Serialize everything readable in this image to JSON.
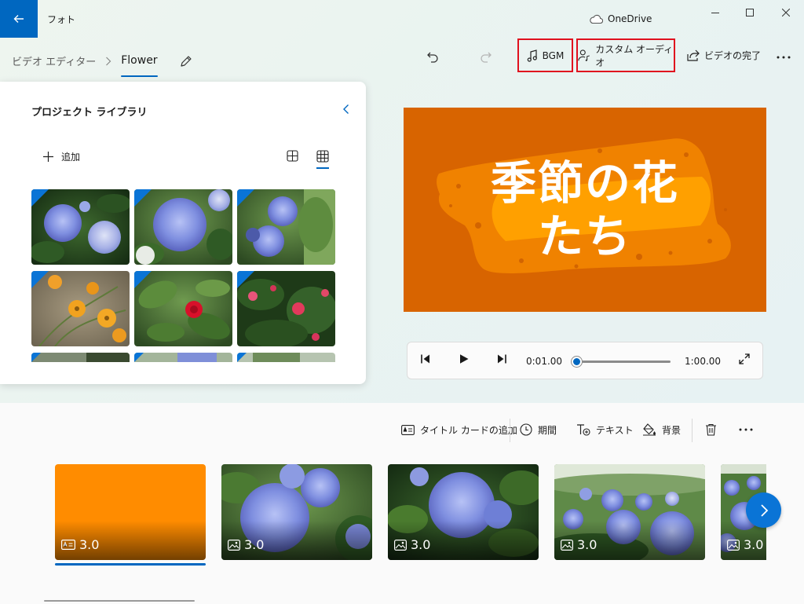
{
  "app": {
    "title": "フォト",
    "onedrive_label": "OneDrive",
    "accent_color": "#0067c0"
  },
  "toolbar": {
    "breadcrumb_root": "ビデオ エディター",
    "project_name": "Flower",
    "bgm_label": "BGM",
    "custom_audio_label": "カスタム オーディオ",
    "finish_video_label": "ビデオの完了",
    "highlight_color": "#e0101e"
  },
  "library": {
    "title": "プロジェクト ライブラリ",
    "add_label": "追加",
    "thumbnails": [
      {
        "subject": "hydrangea",
        "used": true
      },
      {
        "subject": "hydrangea",
        "used": true
      },
      {
        "subject": "hydrangea",
        "used": true
      },
      {
        "subject": "cosmos",
        "used": true
      },
      {
        "subject": "camellia",
        "used": true
      },
      {
        "subject": "camellia",
        "used": true
      }
    ]
  },
  "preview": {
    "title_line1": "季節の花",
    "title_line2": "たち",
    "background_color": "#d86400",
    "current_time": "0:01.00",
    "total_time": "1:00.00",
    "progress": 0.017
  },
  "storyboard": {
    "add_title_card_label": "タイトル カードの追加",
    "duration_label": "期間",
    "text_label": "テキスト",
    "background_label": "背景",
    "clips": [
      {
        "type": "title-card",
        "duration": "3.0",
        "selected": true
      },
      {
        "type": "image",
        "duration": "3.0",
        "selected": false
      },
      {
        "type": "image",
        "duration": "3.0",
        "selected": false
      },
      {
        "type": "image",
        "duration": "3.0",
        "selected": false
      },
      {
        "type": "image",
        "duration": "3.0",
        "selected": false
      }
    ]
  }
}
